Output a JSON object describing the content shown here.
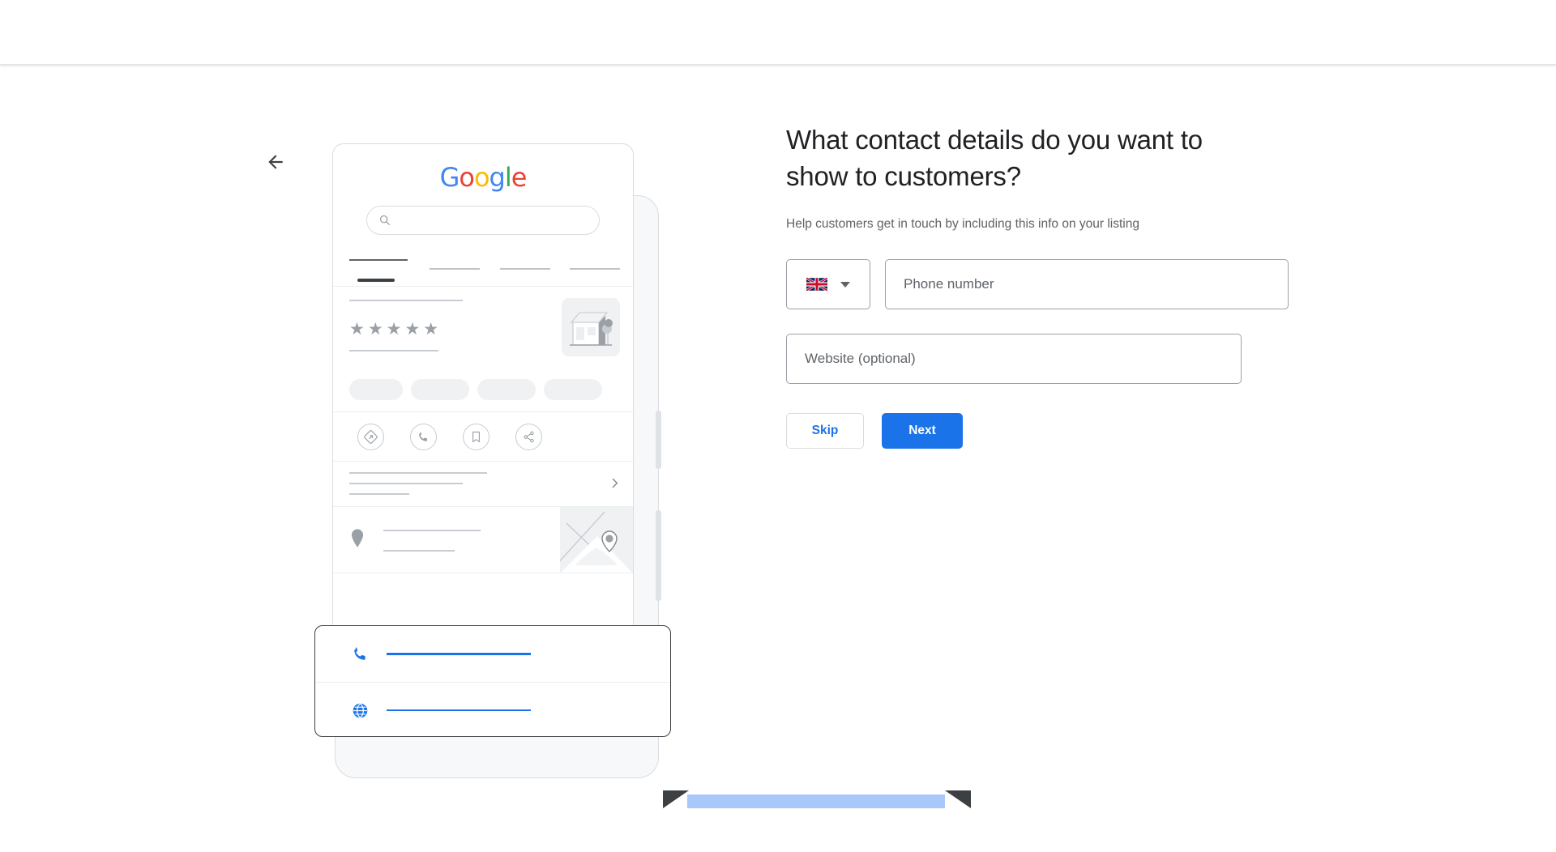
{
  "topbar": {
    "title": ""
  },
  "nav": {
    "back_label": "Back",
    "back_icon": "arrow-left-icon"
  },
  "panel": {
    "headline": "What contact details do you want to show to customers?",
    "subtext": "Help customers get in touch by including this info on your listing",
    "country_selector": {
      "flag": "united-kingdom-flag",
      "selected": "GB",
      "caret_icon": "chevron-down-icon"
    },
    "fields": [
      {
        "name": "phone",
        "value": "",
        "placeholder": "Phone number"
      },
      {
        "name": "website",
        "value": "",
        "placeholder": "Website (optional)"
      }
    ],
    "buttons": {
      "skip": "Skip",
      "next": "Next"
    }
  },
  "colors": {
    "accent": "#1a73e8",
    "text_primary": "#202124",
    "text_secondary": "#5f6368",
    "border": "#9aa0a6",
    "google_blue": "#4285F4",
    "google_red": "#EA4335",
    "google_yellow": "#FBBC05",
    "google_green": "#34A853",
    "highlight_bar": "#a8c7fa"
  },
  "mockup": {
    "google_logo": [
      "G",
      "o",
      "o",
      "g",
      "l",
      "e"
    ],
    "search_icon": "search-icon",
    "rating_stars": "★★★★★",
    "star_count": 5,
    "action_icons": [
      "directions-icon",
      "phone-icon",
      "bookmark-icon",
      "share-icon"
    ],
    "chevron_icon": "chevron-right-icon",
    "place_pin_icon": "map-pin-icon",
    "map_pin_icon": "map-pin-icon",
    "storefront_icon": "storefront-illustration",
    "overlay_rows": [
      {
        "icon": "phone-icon",
        "value": ""
      },
      {
        "icon": "globe-icon",
        "value": ""
      }
    ]
  }
}
